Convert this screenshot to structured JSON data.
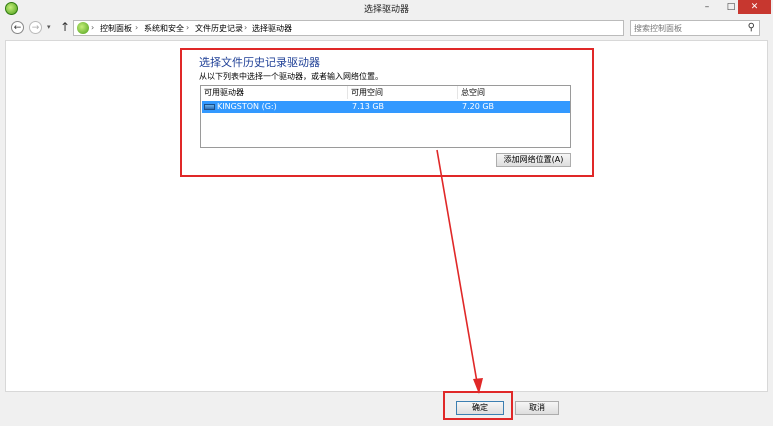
{
  "window": {
    "title": "选择驱动器",
    "controls": {
      "minimize": "–",
      "maximize": "□",
      "close": "✕"
    }
  },
  "address_bar": {
    "breadcrumbs": [
      "控制面板",
      "系统和安全",
      "文件历史记录",
      "选择驱动器"
    ],
    "separator": "›",
    "search_placeholder": "搜索控制面板"
  },
  "section": {
    "title": "选择文件历史记录驱动器",
    "description": "从以下列表中选择一个驱动器，或者输入网络位置。"
  },
  "drive_list": {
    "columns": [
      "可用驱动器",
      "可用空间",
      "总空间"
    ],
    "rows": [
      {
        "name": "KINGSTON (G:)",
        "free": "7.13 GB",
        "total": "7.20 GB",
        "selected": true
      }
    ]
  },
  "buttons": {
    "add_network": "添加网络位置(A)",
    "ok": "确定",
    "cancel": "取消"
  },
  "colors": {
    "highlight": "#e02828",
    "selection": "#3399ff",
    "title_blue": "#1e3f96"
  }
}
